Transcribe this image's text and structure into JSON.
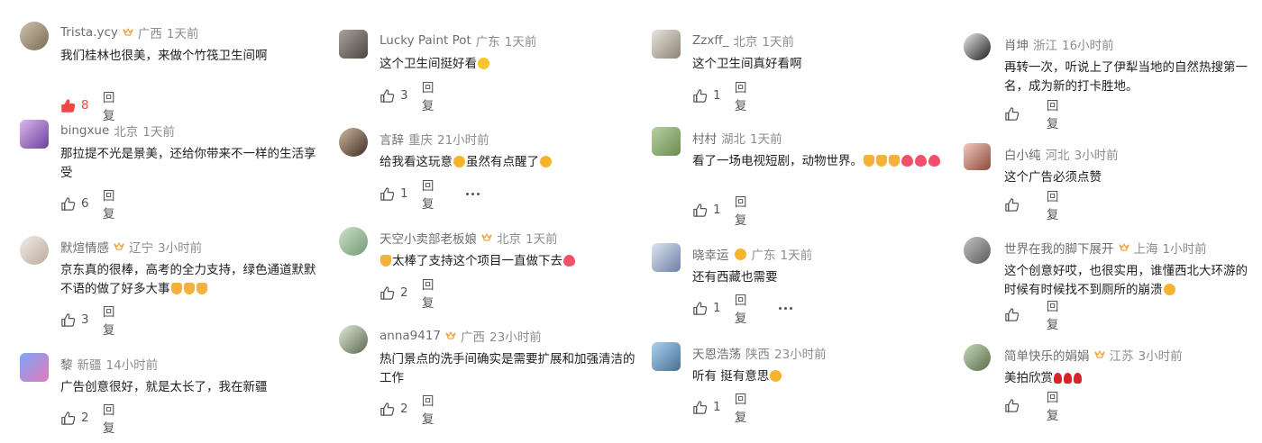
{
  "reply_label": "回复",
  "columns": [
    [
      {
        "name": "Trista.ycy",
        "crown": true,
        "region": "广西",
        "time": "1天前",
        "text": "我们桂林也很美，来做个竹筏卫生间啊",
        "emoji": [],
        "likes": "8",
        "hot": true,
        "more": false
      },
      {
        "name": "bingxue",
        "crown": false,
        "region": "北京",
        "time": "1天前",
        "text": "那拉提不光是景美，还给你带来不一样的生活享受",
        "emoji": [],
        "likes": "6",
        "hot": false,
        "more": false
      },
      {
        "name": "默煊情感",
        "crown": true,
        "region": "辽宁",
        "time": "3小时前",
        "text": "京东真的很棒，高考的全力支持，绿色通道默默不语的做了好多大事",
        "emoji": [
          "thumbs",
          "thumbs",
          "thumbs"
        ],
        "likes": "3",
        "hot": false,
        "more": false
      },
      {
        "name": "黎",
        "crown": false,
        "region": "新疆",
        "time": "14小时前",
        "text": "广告创意很好，就是太长了，我在新疆",
        "emoji": [],
        "likes": "2",
        "hot": false,
        "more": false
      }
    ],
    [
      {
        "name": "Lucky Paint Pot",
        "crown": false,
        "region": "广东",
        "time": "1天前",
        "text": "这个卫生间挺好看",
        "emoji": [
          "grin"
        ],
        "likes": "3",
        "hot": false,
        "more": false
      },
      {
        "name": "言辞",
        "crown": false,
        "region": "重庆",
        "time": "21小时前",
        "text": "给我看这玩意",
        "text2": "虽然有点醒了",
        "emoji": [
          "laugh"
        ],
        "emoji2": [
          "laugh"
        ],
        "likes": "1",
        "hot": false,
        "more": true
      },
      {
        "name": "天空小卖部老板娘",
        "crown": true,
        "region": "北京",
        "time": "1天前",
        "pre_emoji": [
          "thumbs"
        ],
        "text": "太棒了支持这个项目一直做下去",
        "emoji": [
          "heart"
        ],
        "likes": "2",
        "hot": false,
        "more": false
      },
      {
        "name": "anna9417",
        "crown": true,
        "region": "广西",
        "time": "23小时前",
        "text": "热门景点的洗手间确实是需要扩展和加强清洁的工作",
        "emoji": [],
        "likes": "2",
        "hot": false,
        "more": false
      }
    ],
    [
      {
        "name": "Zzxff_",
        "crown": false,
        "region": "北京",
        "time": "1天前",
        "text": "这个卫生间真好看啊",
        "emoji": [],
        "likes": "1",
        "hot": false,
        "more": false
      },
      {
        "name": "村村",
        "crown": false,
        "region": "湖北",
        "time": "1天前",
        "text": "看了一场电视短剧，动物世界。",
        "emoji": [
          "thumbs",
          "thumbs",
          "thumbs",
          "heart",
          "heart",
          "heart"
        ],
        "likes": "1",
        "hot": false,
        "more": false
      },
      {
        "name": "晓幸运",
        "name_emoji": true,
        "crown": false,
        "region": "广东",
        "time": "1天前",
        "text": "还有西藏也需要",
        "emoji": [],
        "likes": "1",
        "hot": false,
        "more": true
      },
      {
        "name": "天恩浩荡",
        "crown": false,
        "region": "陕西",
        "time": "23小时前",
        "text": "听有 挺有意思",
        "emoji": [
          "laugh"
        ],
        "likes": "1",
        "hot": false,
        "more": false
      }
    ],
    [
      {
        "name": "肖坤",
        "crown": false,
        "region": "浙江",
        "time": "16小时前",
        "text": "再转一次，听说上了伊犁当地的自然热搜第一名，成为新的打卡胜地。",
        "emoji": [],
        "likes": "",
        "hot": false,
        "more": false
      },
      {
        "name": "白小纯",
        "crown": false,
        "region": "河北",
        "time": "3小时前",
        "text": "这个广告必须点赞",
        "emoji": [],
        "likes": "",
        "hot": false,
        "more": false
      },
      {
        "name": "世界在我的脚下展开",
        "crown": true,
        "region": "上海",
        "time": "1小时前",
        "text": "这个创意好哎，也很实用，谁懂西北大环游的时候有时候找不到厕所的崩溃",
        "emoji": [
          "laugh"
        ],
        "likes": "",
        "hot": false,
        "more": false
      },
      {
        "name": "简单快乐的娟娟",
        "crown": true,
        "region": "江苏",
        "time": "3小时前",
        "text": "美拍欣赏",
        "emoji": [
          "rose",
          "rose",
          "rose"
        ],
        "likes": "",
        "hot": false,
        "more": false
      }
    ]
  ],
  "avatar_colors": [
    [
      [
        "#cfc4b2",
        "#7a6a4e"
      ],
      [
        "#d9b8f0",
        "#6d3f9a"
      ],
      [
        "#f3eee8",
        "#b9a89a"
      ],
      [
        "#7aa6f7",
        "#e47ab8"
      ]
    ],
    [
      [
        "#a8a39b",
        "#4c463f"
      ],
      [
        "#d0b8a0",
        "#3f2d22"
      ],
      [
        "#cfe2c8",
        "#6f9a72"
      ],
      [
        "#e4e8dc",
        "#566b4d"
      ]
    ],
    [
      [
        "#e8e4dd",
        "#8b8375"
      ],
      [
        "#b6d2a2",
        "#6d8a4e"
      ],
      [
        "#dfe6f0",
        "#6d7fa6"
      ],
      [
        "#a9d2f0",
        "#486f95"
      ]
    ],
    [
      [
        "#e9e9e9",
        "#1c1c1c"
      ],
      [
        "#f3c9c0",
        "#8b4a3a"
      ],
      [
        "#c4c4c4",
        "#5a5a5a"
      ],
      [
        "#c7d9b8",
        "#5a6d4a"
      ]
    ]
  ]
}
